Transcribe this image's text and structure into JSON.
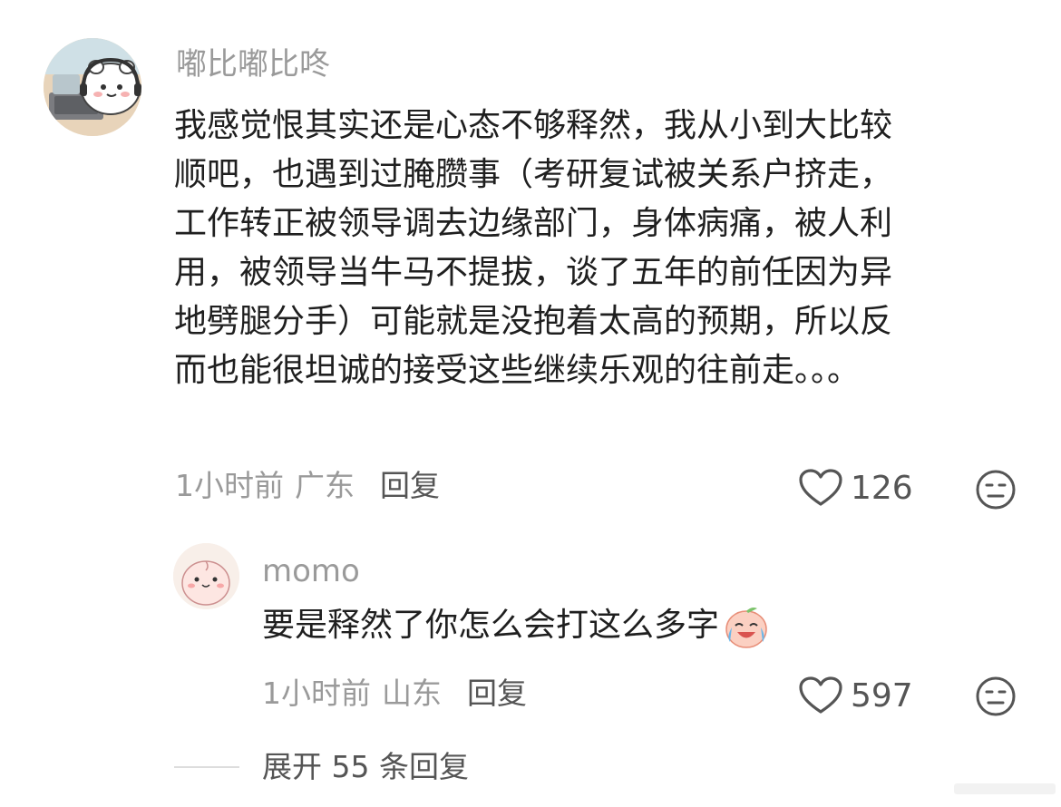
{
  "main_comment": {
    "username": "嘟比嘟比咚",
    "lines": [
      "我感觉恨其实还是心态不够释然，我从小到大比较",
      "顺吧，也遇到过腌臜事（考研复试被关系户挤走，",
      "工作转正被领导调去边缘部门，身体病痛，被人利",
      "用，被领导当牛马不提拔，谈了五年的前任因为异",
      "地劈腿分手）可能就是没抱着太高的预期，所以反",
      "而也能很坦诚的接受这些继续乐观的往前走。。。"
    ],
    "time": "1小时前",
    "location": "广东",
    "reply_label": "回复",
    "likes": "126",
    "icons": {
      "avatar": "avatar-cartoon-headset",
      "like": "heart-outline-icon",
      "dislike": "neutral-face-icon"
    }
  },
  "reply_comment": {
    "username": "momo",
    "text": "要是释然了你怎么会打这么多字",
    "emoji": "laugh-cry-emoji",
    "time": "1小时前",
    "location": "山东",
    "reply_label": "回复",
    "likes": "597"
  },
  "expand": {
    "label": "展开 55 条回复"
  },
  "colors": {
    "text": "#1f1f1f",
    "meta": "#9a9a9a",
    "action": "#555555",
    "background": "#ffffff"
  }
}
